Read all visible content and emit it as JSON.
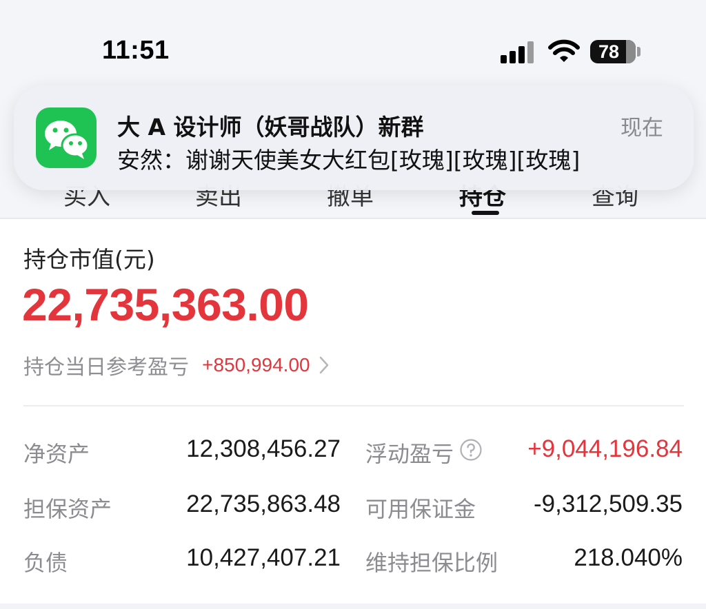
{
  "status_bar": {
    "time": "11:51",
    "battery": "78"
  },
  "tabs": [
    {
      "label": "买入"
    },
    {
      "label": "卖出"
    },
    {
      "label": "撤单"
    },
    {
      "label": "持仓"
    },
    {
      "label": "查询"
    }
  ],
  "notification": {
    "title": "大 A 设计师（妖哥战队）新群",
    "time": "现在",
    "message": "安然：谢谢天使美女大红包[玫瑰][玫瑰][玫瑰]",
    "app_icon": "wechat-icon"
  },
  "summary": {
    "market_value_label": "持仓市值(元)",
    "market_value": "22,735,363.00",
    "daily_pnl_label": "持仓当日参考盈亏",
    "daily_pnl_value": "+850,994.00"
  },
  "metrics": {
    "net_assets_label": "净资产",
    "net_assets": "12,308,456.27",
    "floating_pnl_label": "浮动盈亏",
    "floating_pnl": "+9,044,196.84",
    "collateral_label": "担保资产",
    "collateral": "22,735,863.48",
    "available_margin_label": "可用保证金",
    "available_margin": "-9,312,509.35",
    "liabilities_label": "负债",
    "liabilities": "10,427,407.21",
    "maintenance_ratio_label": "维持担保比例",
    "maintenance_ratio": "218.040%"
  },
  "colors": {
    "accent_red": "#e3353c",
    "wechat_green": "#1ec354"
  }
}
